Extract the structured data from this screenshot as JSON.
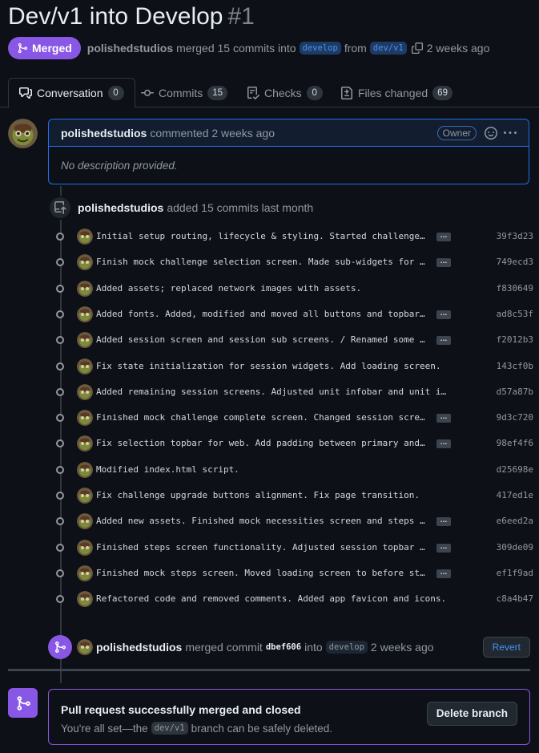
{
  "pr": {
    "title": "Dev/v1 into Develop",
    "number": "#1",
    "status": "Merged",
    "author": "polishedstudios",
    "merged_text": "merged 15 commits into",
    "base_branch": "develop",
    "from_text": "from",
    "head_branch": "dev/v1",
    "time": "2 weeks ago"
  },
  "tabs": [
    {
      "label": "Conversation",
      "count": "0",
      "icon": "comment-discussion-icon"
    },
    {
      "label": "Commits",
      "count": "15",
      "icon": "git-commit-icon"
    },
    {
      "label": "Checks",
      "count": "0",
      "icon": "checklist-icon"
    },
    {
      "label": "Files changed",
      "count": "69",
      "icon": "file-diff-icon"
    }
  ],
  "comment": {
    "author": "polishedstudios",
    "action": "commented 2 weeks ago",
    "badge": "Owner",
    "body": "No description provided."
  },
  "push_event": {
    "author": "polishedstudios",
    "text": "added 15 commits last month"
  },
  "commits": [
    {
      "message": "Initial setup routing, lifecycle & styling. Started challenge selection screen.",
      "sha": "39f3d23",
      "more": true
    },
    {
      "message": "Finish mock challenge selection screen. Made sub-widgets for cleaner code.",
      "sha": "749ecd3",
      "more": true
    },
    {
      "message": "Added assets; replaced network images with assets.",
      "sha": "f830649",
      "more": false
    },
    {
      "message": "Added fonts. Added, modified and moved all buttons and topbars to new folder.",
      "sha": "ad8c53f",
      "more": true
    },
    {
      "message": "Added session screen and session sub screens. / Renamed some files. Added more.",
      "sha": "f2012b3",
      "more": true
    },
    {
      "message": "Fix state initialization for session widgets. Add loading screen.",
      "sha": "143cf0b",
      "more": false
    },
    {
      "message": "Added remaining session screens. Adjusted unit infobar and unit images.",
      "sha": "d57a87b",
      "more": false
    },
    {
      "message": "Finished mock challenge complete screen. Changed session screens order and more.",
      "sha": "9d3c720",
      "more": true
    },
    {
      "message": "Fix selection topbar for web. Add padding between primary and secondary buttons.",
      "sha": "98ef4f6",
      "more": true
    },
    {
      "message": "Modified index.html script.",
      "sha": "d25698e",
      "more": false
    },
    {
      "message": "Fix challenge upgrade buttons alignment. Fix page transition.",
      "sha": "417ed1e",
      "more": false
    },
    {
      "message": "Added new assets. Finished mock necessities screen and steps overview screen.",
      "sha": "e6eed2a",
      "more": true
    },
    {
      "message": "Finished steps screen functionality. Adjusted session topbar with Dots indicator.",
      "sha": "309de09",
      "more": true
    },
    {
      "message": "Finished mock steps screen. Moved loading screen to before steps. Changed more.",
      "sha": "ef1f9ad",
      "more": true
    },
    {
      "message": "Refactored code and removed comments. Added app favicon and icons.",
      "sha": "c8a4b47",
      "more": false
    }
  ],
  "merge_event": {
    "author": "polishedstudios",
    "text": "merged commit",
    "sha": "dbef606",
    "into": "into",
    "branch": "develop",
    "time": "2 weeks ago",
    "revert_label": "Revert"
  },
  "merged_box": {
    "title": "Pull request successfully merged and closed",
    "sub_prefix": "You're all set—the",
    "branch": "dev/v1",
    "sub_suffix": "branch can be safely deleted.",
    "delete_label": "Delete branch"
  },
  "colors": {
    "merged": "#8957e5",
    "link": "#4493f8",
    "bg": "#0d1117"
  }
}
